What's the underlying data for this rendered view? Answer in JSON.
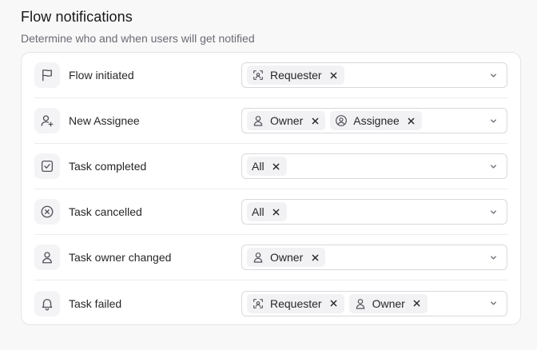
{
  "header": {
    "title": "Flow notifications",
    "subtitle": "Determine who and when users will get notified"
  },
  "rows": [
    {
      "label": "Flow initiated",
      "icon": "flag-icon",
      "chips": [
        {
          "label": "Requester",
          "icon": "requester-icon"
        }
      ]
    },
    {
      "label": "New Assignee",
      "icon": "user-plus-icon",
      "chips": [
        {
          "label": "Owner",
          "icon": "user-icon"
        },
        {
          "label": "Assignee",
          "icon": "user-circle-icon"
        }
      ]
    },
    {
      "label": "Task completed",
      "icon": "check-square-icon",
      "chips": [
        {
          "label": "All",
          "icon": ""
        }
      ]
    },
    {
      "label": "Task cancelled",
      "icon": "x-circle-icon",
      "chips": [
        {
          "label": "All",
          "icon": ""
        }
      ]
    },
    {
      "label": "Task owner changed",
      "icon": "user-icon",
      "chips": [
        {
          "label": "Owner",
          "icon": "user-icon"
        }
      ]
    },
    {
      "label": "Task failed",
      "icon": "bell-icon",
      "chips": [
        {
          "label": "Requester",
          "icon": "requester-icon"
        },
        {
          "label": "Owner",
          "icon": "user-icon"
        }
      ]
    }
  ],
  "colors": {
    "icon_stroke": "#52525b",
    "chip_bg": "#f2f2f4",
    "border": "#d9d9de"
  }
}
